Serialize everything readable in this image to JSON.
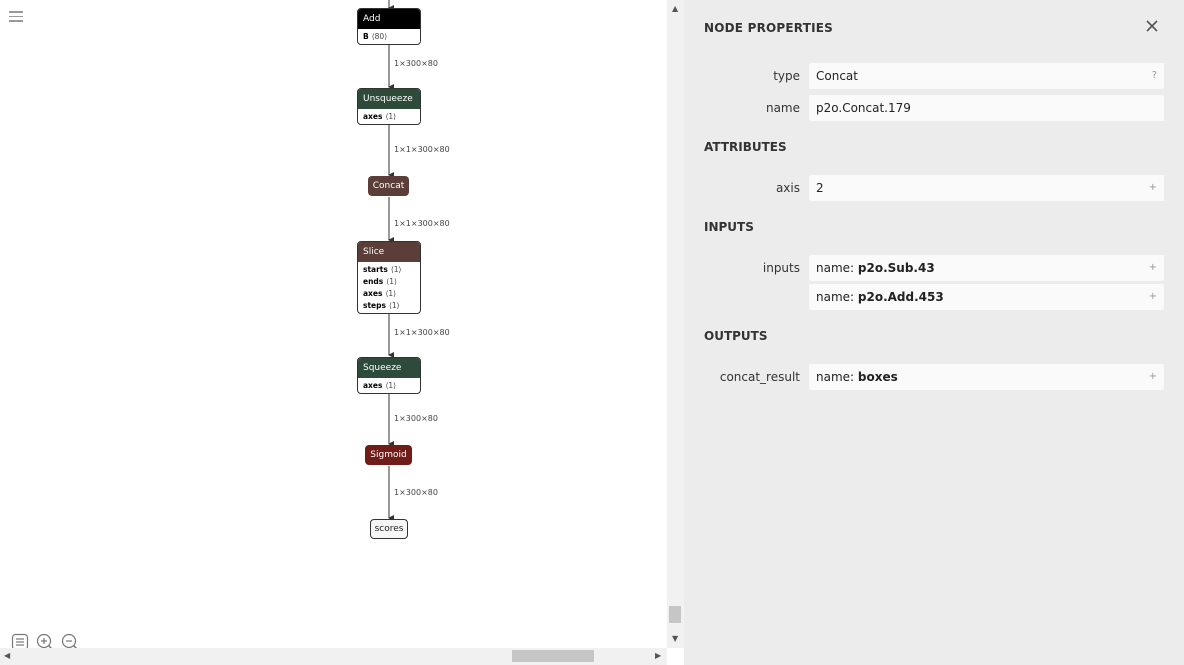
{
  "graph": {
    "nodes": {
      "add": {
        "title": "Add",
        "attrs": [
          {
            "name": "B",
            "value": "⟨80⟩"
          }
        ]
      },
      "unsqueeze": {
        "title": "Unsqueeze",
        "attrs": [
          {
            "name": "axes",
            "value": "⟨1⟩"
          }
        ]
      },
      "concat": {
        "title": "Concat"
      },
      "slice": {
        "title": "Slice",
        "attrs": [
          {
            "name": "starts",
            "value": "⟨1⟩"
          },
          {
            "name": "ends",
            "value": "⟨1⟩"
          },
          {
            "name": "axes",
            "value": "⟨1⟩"
          },
          {
            "name": "steps",
            "value": "⟨1⟩"
          }
        ]
      },
      "squeeze": {
        "title": "Squeeze",
        "attrs": [
          {
            "name": "axes",
            "value": "⟨1⟩"
          }
        ]
      },
      "sigmoid": {
        "title": "Sigmoid"
      },
      "scores": {
        "title": "scores"
      }
    },
    "edge_labels": [
      "1×300×80",
      "1×1×300×80",
      "1×1×300×80",
      "1×1×300×80",
      "1×300×80",
      "1×300×80"
    ],
    "colors": {
      "math": "#000000",
      "shape": "#2e4a3b",
      "tensor": "#5a3e37",
      "activation": "#701d1a"
    },
    "icons": [
      "menu-icon",
      "list-icon",
      "zoom-in-icon",
      "zoom-out-icon"
    ]
  },
  "panel": {
    "title": "NODE PROPERTIES",
    "type_label": "type",
    "type_value": "Concat",
    "type_button": "?",
    "name_label": "name",
    "name_value": "p2o.Concat.179",
    "attributes_title": "ATTRIBUTES",
    "attributes": [
      {
        "label": "axis",
        "value": "2",
        "button": "+"
      }
    ],
    "inputs_title": "INPUTS",
    "inputs_label": "inputs",
    "inputs": [
      {
        "prefix": "name: ",
        "value": "p2o.Sub.43",
        "button": "+"
      },
      {
        "prefix": "name: ",
        "value": "p2o.Add.453",
        "button": "+"
      }
    ],
    "outputs_title": "OUTPUTS",
    "outputs": [
      {
        "label": "concat_result",
        "prefix": "name: ",
        "value": "boxes",
        "button": "+"
      }
    ]
  }
}
